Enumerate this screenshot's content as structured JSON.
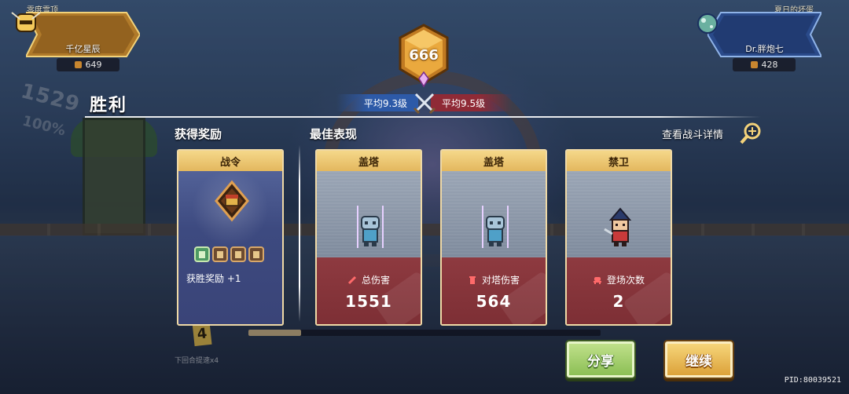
{
  "top": {
    "left_team": {
      "label": "零度雪顶",
      "player": "千亿星辰",
      "score": "649",
      "color": "#b07a2a"
    },
    "right_team": {
      "label": "夏日的坏蛋",
      "player": "Dr.胖炮七",
      "score": "428",
      "color": "#2a4a8a"
    },
    "center_score": "666",
    "avg_left": "平均9.3级",
    "avg_right": "平均9.5级"
  },
  "result": {
    "title": "胜利"
  },
  "sections": {
    "rewards_title": "获得奖励",
    "best_title": "最佳表现",
    "details_link": "查看战斗详情"
  },
  "reward_card": {
    "title": "战令",
    "label": "获胜奖励 +1",
    "slots_filled": 1,
    "slots_total": 4
  },
  "perf_cards": [
    {
      "title": "盖塔",
      "stat_icon": "sword-icon",
      "stat_label": "总伤害",
      "value": "1551"
    },
    {
      "title": "盖塔",
      "stat_icon": "tower-icon",
      "stat_label": "对塔伤害",
      "value": "564"
    },
    {
      "title": "禁卫",
      "stat_icon": "deploy-icon",
      "stat_label": "登场次数",
      "value": "2"
    }
  ],
  "progress": {
    "fraction": 0.15
  },
  "buttons": {
    "share": "分享",
    "continue": "继续"
  },
  "footer": {
    "pid": "PID:80039521"
  },
  "background": {
    "caption": "下回合提速x4",
    "counter": "4",
    "score_fx": "1529",
    "percent_fx": "100%"
  },
  "colors": {
    "card_border": "#efd9a6",
    "card_header": "#e3b75e",
    "card_stat_bg": "#8e3a40",
    "share_green": "#8cbf55",
    "continue_gold": "#dca23a"
  }
}
